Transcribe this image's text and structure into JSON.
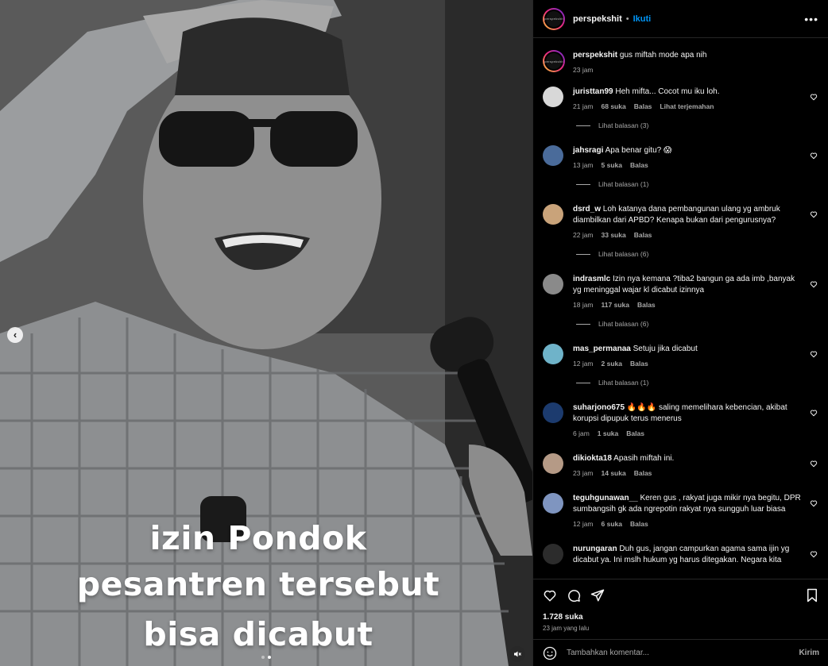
{
  "post": {
    "username": "perspekshit",
    "separator": "•",
    "follow_label": "Ikuti",
    "more_label": "•••",
    "avatar_text": "perspekshit",
    "caption_user": "perspekshit",
    "caption_text": "gus miftah mode apa nih",
    "caption_time": "23 jam"
  },
  "media": {
    "caption_line1": "izin Pondok",
    "caption_line2": "pesantren tersebut",
    "caption_line3": "bisa dicabut",
    "prev_icon": "‹",
    "mute_icon": "🔇",
    "slide_count": 2,
    "active_slide": 2
  },
  "comments": [
    {
      "user": "juristtan99",
      "text": "Heh mifta... Cocot mu iku loh.",
      "time": "21 jam",
      "likes": "68 suka",
      "reply": "Balas",
      "extra": "Lihat terjemahan",
      "replies": "Lihat balasan (3)",
      "avatar_color": "#d8d8d8"
    },
    {
      "user": "jahsragi",
      "text": "Apa benar gitu? 😱",
      "time": "13 jam",
      "likes": "5 suka",
      "reply": "Balas",
      "extra": "",
      "replies": "Lihat balasan (1)",
      "avatar_color": "#4a6b9a"
    },
    {
      "user": "dsrd_w",
      "text": "Loh katanya dana pembangunan ulang yg ambruk diambilkan dari APBD? Kenapa bukan dari pengurusnya?",
      "time": "22 jam",
      "likes": "33 suka",
      "reply": "Balas",
      "extra": "",
      "replies": "Lihat balasan (6)",
      "avatar_color": "#c9a37a"
    },
    {
      "user": "indrasmlc",
      "text": "Izin nya kemana ?tiba2 bangun ga ada imb ,banyak yg meninggal wajar kl dicabut izinnya",
      "time": "18 jam",
      "likes": "117 suka",
      "reply": "Balas",
      "extra": "",
      "replies": "Lihat balasan (6)",
      "avatar_color": "#8a8a8a"
    },
    {
      "user": "mas_permanaa",
      "text": "Setuju jika dicabut",
      "time": "12 jam",
      "likes": "2 suka",
      "reply": "Balas",
      "extra": "",
      "replies": "Lihat balasan (1)",
      "avatar_color": "#6fb3c9"
    },
    {
      "user": "suharjono675",
      "text": "🔥🔥🔥 saling memelihara kebencian, akibat korupsi dipupuk terus menerus",
      "time": "6 jam",
      "likes": "1 suka",
      "reply": "Balas",
      "extra": "",
      "replies": "",
      "avatar_color": "#1c3b6e"
    },
    {
      "user": "dikiokta18",
      "text": "Apasih miftah ini.",
      "time": "23 jam",
      "likes": "14 suka",
      "reply": "Balas",
      "extra": "",
      "replies": "",
      "avatar_color": "#b59a86"
    },
    {
      "user": "teguhgunawan__",
      "text": "Keren gus , rakyat juga mikir nya begitu, DPR sumbangsih gk ada ngrepotin rakyat nya sungguh luar biasa",
      "time": "12 jam",
      "likes": "6 suka",
      "reply": "Balas",
      "extra": "",
      "replies": "",
      "avatar_color": "#7f95c0"
    },
    {
      "user": "nurungaran",
      "text": "Duh gus, jangan campurkan agama sama ijin yg dicabut ya. Ini mslh hukum yg harus ditegakan. Negara kita",
      "time": "",
      "likes": "",
      "reply": "",
      "extra": "",
      "replies": "",
      "avatar_color": "#2c2c2c"
    }
  ],
  "actions": {
    "likes": "1.728 suka",
    "time": "23 jam yang lalu"
  },
  "composer": {
    "placeholder": "Tambahkan komentar...",
    "post_label": "Kirim"
  }
}
